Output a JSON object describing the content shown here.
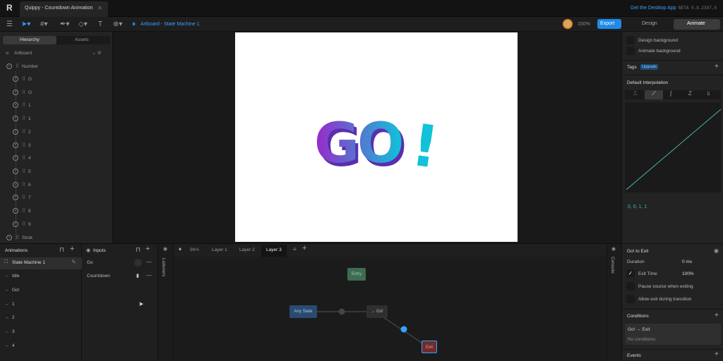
{
  "app": {
    "tab_title": "Quippy - Countdown Animation",
    "desktop_link": "Get the Desktop App",
    "version": "BETA 0.8.2307.0"
  },
  "toolbar": {
    "breadcrumb": "Artboard - State Machine 1",
    "zoom": "150%",
    "export_label": "Export",
    "mode_design": "Design",
    "mode_animate": "Animate"
  },
  "hierarchy": {
    "tab_hierarchy": "Hierarchy",
    "tab_assets": "Assets",
    "root": "Artboard",
    "group": "Number",
    "children": [
      "G",
      "O",
      "1",
      "1",
      "2",
      "3",
      "4",
      "5",
      "6",
      "7",
      "8",
      "9"
    ],
    "last": "Strok"
  },
  "artboard_text": {
    "go": "GO",
    "bang": "!"
  },
  "animations": {
    "title": "Animations",
    "items": [
      "State Machine 1",
      "Idle",
      "Go!",
      "1",
      "2",
      "3",
      "4"
    ]
  },
  "inputs": {
    "title": "Inputs",
    "items": [
      {
        "name": "Go",
        "kind": "trigger"
      },
      {
        "name": "Countdown",
        "kind": "number"
      }
    ]
  },
  "listeners_label": "Listeners",
  "console_label": "Console",
  "graph": {
    "zoom": "96%",
    "layers": [
      "Layer 1",
      "Layer 2",
      "Layer 3"
    ],
    "active_layer": "Layer 3",
    "nodes": {
      "entry": "Entry",
      "any_state": "Any State",
      "go": "→ Go!",
      "exit": "Exit"
    }
  },
  "right": {
    "design_background": "Design background",
    "animate_background": "Animate background",
    "tags": "Tags",
    "upgrade": "Upgrade",
    "default_interpolation": "Default Interpolation",
    "curve_values": "0, 0, 1, 1",
    "transition_title": "Go! to Exit",
    "duration_label": "Duration",
    "duration_value": "0 ms",
    "exit_time_label": "Exit Time",
    "exit_time_value": "100%",
    "pause_source": "Pause source when exiting",
    "allow_exit": "Allow exit during transition",
    "conditions": "Conditions",
    "condition_title": "Go! → Exit",
    "no_conditions": "No conditions",
    "events": "Events"
  },
  "colors": {
    "accent": "#3aa0ff",
    "go_gradient_start": "#9b27c9",
    "go_gradient_end": "#11c2d8"
  }
}
